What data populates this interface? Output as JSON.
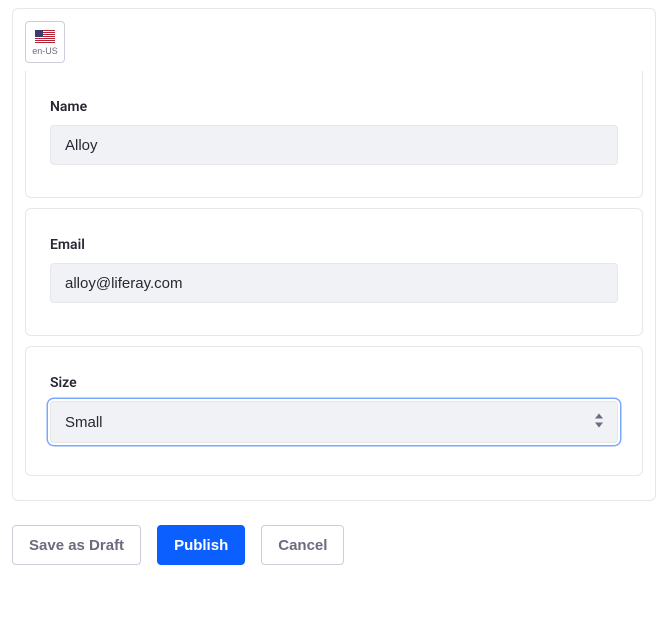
{
  "locale": {
    "code": "en-US",
    "flag": "🇺🇸"
  },
  "fields": {
    "name": {
      "label": "Name",
      "value": "Alloy"
    },
    "email": {
      "label": "Email",
      "value": "alloy@liferay.com"
    },
    "size": {
      "label": "Size",
      "value": "Small"
    }
  },
  "buttons": {
    "save_draft": "Save as Draft",
    "publish": "Publish",
    "cancel": "Cancel"
  }
}
